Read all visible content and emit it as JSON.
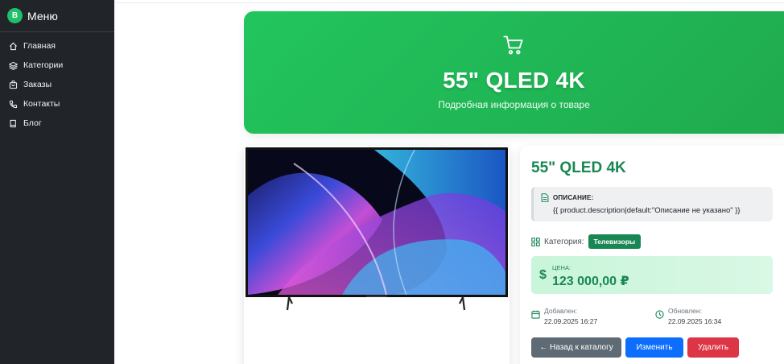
{
  "sidebar": {
    "brand_letter": "B",
    "brand": "Меню",
    "items": [
      {
        "label": "Главная",
        "icon": "home-icon"
      },
      {
        "label": "Категории",
        "icon": "layers-icon"
      },
      {
        "label": "Заказы",
        "icon": "bag-icon"
      },
      {
        "label": "Контакты",
        "icon": "phone-icon"
      },
      {
        "label": "Блог",
        "icon": "book-icon"
      }
    ]
  },
  "hero": {
    "icon": "cart-icon",
    "title": "55\" QLED 4K",
    "subtitle": "Подробная информация о товаре"
  },
  "product": {
    "image_icon": "tv-image",
    "title": "55\" QLED 4K",
    "description_label": "ОПИСАНИЕ:",
    "description": "{{ product.description|default:\"Описание не указано\" }}",
    "category_label": "Категория:",
    "category": "Телевизоры",
    "price_label": "ЦЕНА:",
    "price": "123 000,00 ₽",
    "added_label": "Добавлен:",
    "added": "22.09.2025 16:27",
    "updated_label": "Обновлен:",
    "updated": "22.09.2025 16:34"
  },
  "actions": {
    "back": "← Назад к каталогу",
    "edit": "Изменить",
    "delete": "Удалить"
  },
  "colors": {
    "accent": "#198754",
    "hero_start": "#22c55e",
    "sidebar_bg": "#212529",
    "edit": "#0d6efd",
    "delete": "#dc3545",
    "back": "#5f6b74"
  }
}
